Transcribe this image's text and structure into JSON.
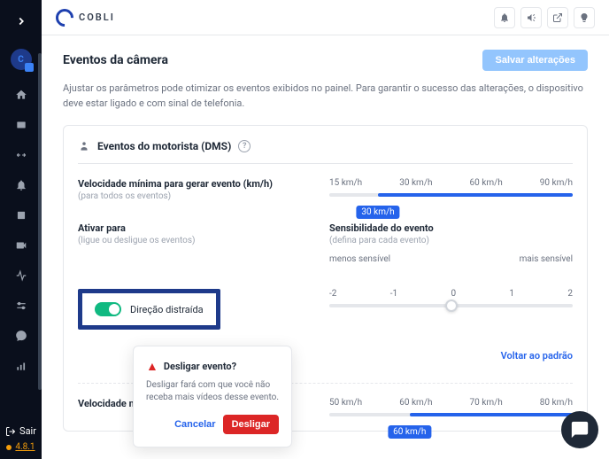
{
  "brand": "COBLI",
  "sidebar": {
    "exit_label": "Sair",
    "version": "4.8.1"
  },
  "topbar_icons": [
    "bell",
    "megaphone",
    "external",
    "lightbulb"
  ],
  "page": {
    "title": "Eventos da câmera",
    "save_label": "Salvar alterações",
    "description": "Ajustar os parâmetros pode otimizar os eventos exibidos no painel. Para garantir o sucesso das alterações, o dispositivo deve estar ligado e com sinal de telefonia."
  },
  "dms": {
    "section_title": "Eventos do motorista (DMS)",
    "min_speed_label": "Velocidade mínima para gerar evento (km/h)",
    "min_speed_sub": "(para todos os eventos)",
    "slider1": {
      "ticks": [
        "15 km/h",
        "30 km/h",
        "60 km/h",
        "90 km/h"
      ],
      "value_label": "30 km/h",
      "fill_left_pct": 20,
      "handle_pct": 20
    },
    "activate_label": "Ativar para",
    "activate_sub": "(ligue ou desligue os eventos)",
    "sensitivity_label": "Sensibilidade do evento",
    "sensitivity_sub": "(defina para cada evento)",
    "sens_less": "menos sensível",
    "sens_more": "mais sensível",
    "sens_ticks": [
      "-2",
      "-1",
      "0",
      "1",
      "2"
    ],
    "sens_handle_pct": 50,
    "toggle_label": "Direção distraída",
    "reset_label": "Voltar ao padrão",
    "slider2": {
      "ticks": [
        "50 km/h",
        "60 km/h",
        "70 km/h",
        "80 km/h"
      ],
      "value_label": "60 km/h",
      "fill_left_pct": 33,
      "handle_pct": 33
    },
    "min_speed_label2": "Velocidade mínima para gerar evento (km/h)"
  },
  "popover": {
    "title": "Desligar evento?",
    "text": "Desligar fará com que você não receba mais vídeos desse evento.",
    "cancel": "Cancelar",
    "confirm": "Desligar"
  }
}
